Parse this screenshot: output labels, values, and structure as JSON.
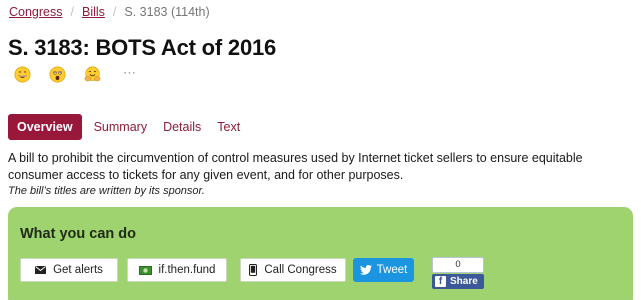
{
  "breadcrumb": {
    "items": [
      "Congress",
      "Bills"
    ],
    "current": "S. 3183 (114th)"
  },
  "page_title": "S. 3183: BOTS Act of 2016",
  "reactions": {
    "icons": [
      "grinning-face-icon",
      "astonished-face-icon",
      "hugging-face-icon"
    ],
    "more": "⋯"
  },
  "tabs": [
    "Overview",
    "Summary",
    "Details",
    "Text"
  ],
  "summary": "A bill to prohibit the circumvention of control measures used by Internet ticket sellers to ensure equitable consumer access to tickets for any given event, and for other purposes.",
  "sponsor_note": "The bill’s titles are written by its sponsor.",
  "actions": {
    "heading": "What you can do",
    "get_alerts": "Get alerts",
    "fund": "if.then.fund",
    "call": "Call Congress",
    "tweet": "Tweet",
    "fb_count": "0",
    "fb_share": "Share"
  },
  "colors": {
    "accent": "#98183c",
    "link": "#8e1c3b",
    "action_box": "#9ed36f",
    "tweet": "#1b95e0",
    "facebook": "#3b5998"
  }
}
